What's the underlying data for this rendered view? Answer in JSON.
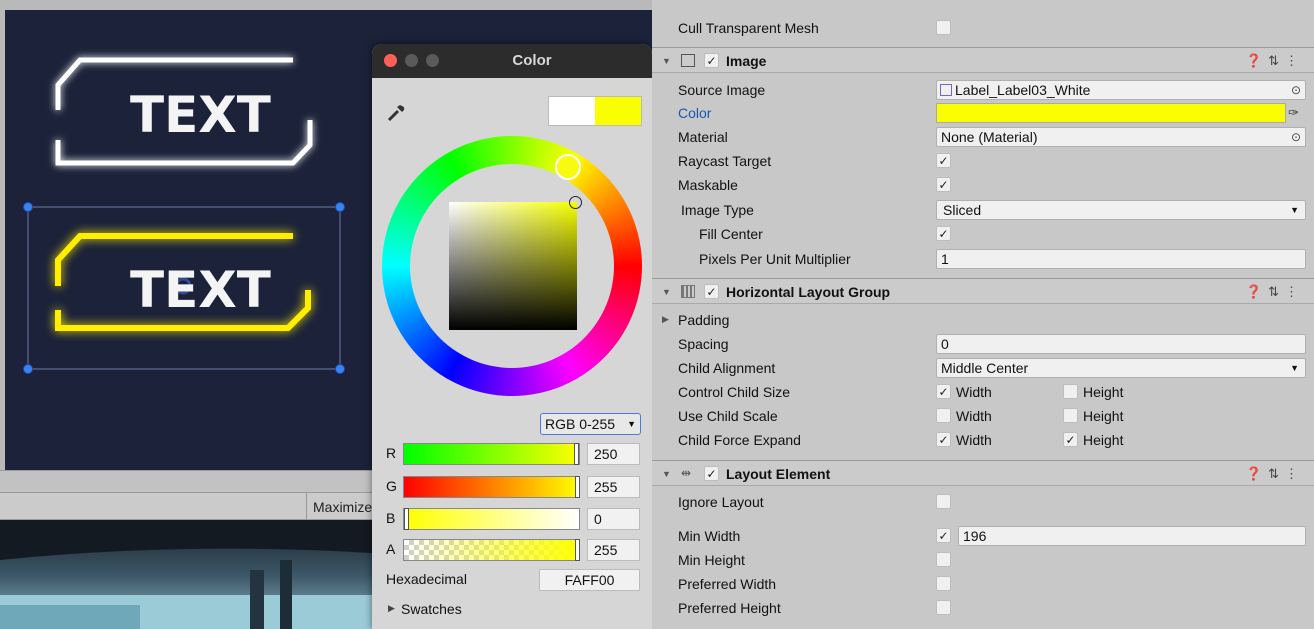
{
  "colors": {
    "accent_yellow": "#FAFF00",
    "scene_bg": "#1b2239",
    "selection_blue": "#3b82f6"
  },
  "scene": {
    "label_top_text": "TEXT",
    "label_bottom_text": "TEXT",
    "maximize_label": "Maximize"
  },
  "picker": {
    "title": "Color",
    "mode": "RGB 0-255",
    "channels": [
      {
        "name": "R",
        "value": "250"
      },
      {
        "name": "G",
        "value": "255"
      },
      {
        "name": "B",
        "value": "0"
      },
      {
        "name": "A",
        "value": "255"
      }
    ],
    "hex_label": "Hexadecimal",
    "hex_value": "FAFF00",
    "swatches_label": "Swatches",
    "icons": [
      "eyedropper-icon",
      "disclosure-triangle-icon"
    ]
  },
  "inspector": {
    "cull_transparent_mesh": "Cull Transparent Mesh",
    "image": {
      "title": "Image",
      "source_image_label": "Source Image",
      "source_image_value": "Label_Label03_White",
      "color_label": "Color",
      "material_label": "Material",
      "material_value": "None (Material)",
      "raycast_label": "Raycast Target",
      "maskable_label": "Maskable",
      "image_type_label": "Image Type",
      "image_type_value": "Sliced",
      "fill_center_label": "Fill Center",
      "ppu_label": "Pixels Per Unit Multiplier",
      "ppu_value": "1"
    },
    "hlg": {
      "title": "Horizontal Layout Group",
      "padding_label": "Padding",
      "spacing_label": "Spacing",
      "spacing_value": "0",
      "child_alignment_label": "Child Alignment",
      "child_alignment_value": "Middle Center",
      "control_child_size_label": "Control Child Size",
      "use_child_scale_label": "Use Child Scale",
      "child_force_expand_label": "Child Force Expand",
      "width_label": "Width",
      "height_label": "Height"
    },
    "layout_element": {
      "title": "Layout Element",
      "ignore_layout_label": "Ignore Layout",
      "min_width_label": "Min Width",
      "min_width_value": "196",
      "min_height_label": "Min Height",
      "preferred_width_label": "Preferred Width",
      "preferred_height_label": "Preferred Height"
    }
  }
}
